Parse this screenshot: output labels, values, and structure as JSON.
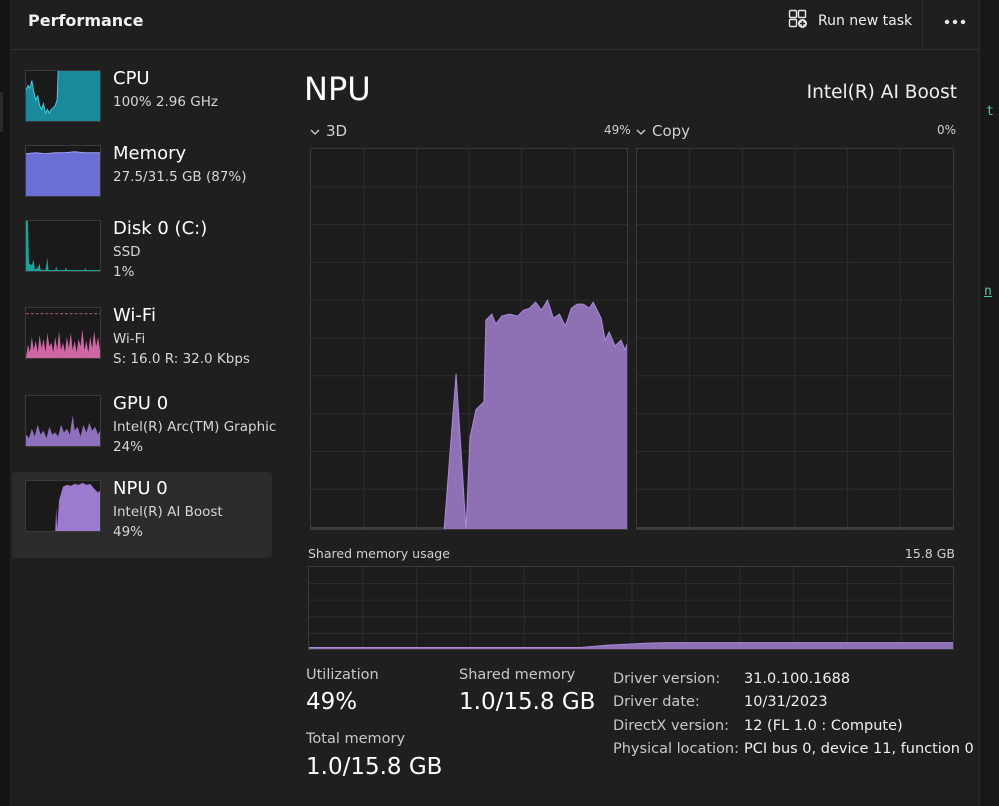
{
  "header": {
    "title": "Performance",
    "run_task_label": "Run new task",
    "more_label": "•••"
  },
  "sidebar": {
    "items": [
      {
        "name": "CPU",
        "line1": "100%  2.96 GHz",
        "line2": "",
        "color": "#17a0b0",
        "active": false
      },
      {
        "name": "Memory",
        "line1": "27.5/31.5 GB (87%)",
        "line2": "",
        "color": "#6a6fd6",
        "active": false
      },
      {
        "name": "Disk 0 (C:)",
        "line1": "SSD",
        "line2": "1%",
        "color": "#1ba39c",
        "active": false
      },
      {
        "name": "Wi-Fi",
        "line1": "Wi-Fi",
        "line2": "S: 16.0  R: 32.0 Kbps",
        "color": "#e26fb4",
        "active": false
      },
      {
        "name": "GPU 0",
        "line1": "Intel(R) Arc(TM) Graphic",
        "line2": "24%",
        "color": "#9c7ad0",
        "active": false
      },
      {
        "name": "NPU 0",
        "line1": "Intel(R) AI Boost",
        "line2": "49%",
        "color": "#9c7ad0",
        "active": true
      }
    ]
  },
  "main": {
    "title": "NPU",
    "device": "Intel(R) AI Boost",
    "engines": [
      {
        "name": "3D",
        "percent": "49%"
      },
      {
        "name": "Copy",
        "percent": "0%"
      }
    ],
    "shared_memory_usage_label": "Shared memory usage",
    "shared_memory_usage_max": "15.8 GB",
    "stats": {
      "utilization_label": "Utilization",
      "utilization_value": "49%",
      "shared_memory_label": "Shared memory",
      "shared_memory_value": "1.0/15.8 GB",
      "total_memory_label": "Total memory",
      "total_memory_value": "1.0/15.8 GB"
    },
    "info": [
      {
        "key": "Driver version:",
        "value": "31.0.100.1688"
      },
      {
        "key": "Driver date:",
        "value": "10/31/2023"
      },
      {
        "key": "DirectX version:",
        "value": "12 (FL 1.0 : Compute)"
      },
      {
        "key": "Physical location:",
        "value": "PCI bus 0, device 11, function 0"
      }
    ]
  },
  "colors": {
    "npu_fill": "#8e71b5",
    "npu_line": "#a98ad6",
    "grid": "#2c2c2c",
    "background": "#1f1f1f"
  },
  "icons": {
    "run_task": "add-task-icon",
    "more": "more-options-icon",
    "chevron": "chevron-down-icon"
  }
}
